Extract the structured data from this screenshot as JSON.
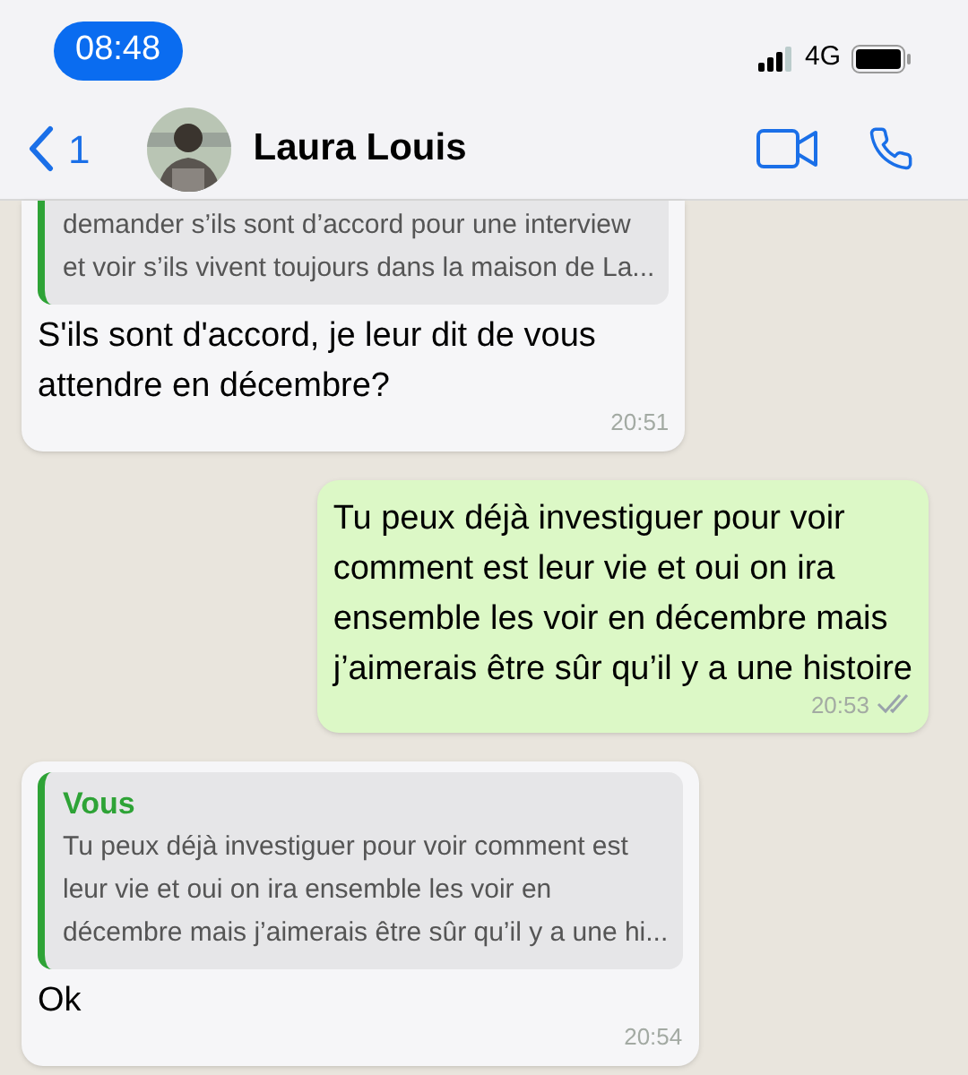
{
  "status_bar": {
    "time": "08:48",
    "network": "4G"
  },
  "header": {
    "back_count": "1",
    "contact": "Laura Louis"
  },
  "messages": [
    {
      "kind": "incoming",
      "quote": {
        "lines": [
          "demander s’ils sont d’accord pour une interview",
          "et voir s’ils vivent toujours dans la maison de La..."
        ]
      },
      "lines": [
        "S'ils sont d'accord, je leur dit de vous",
        "attendre en décembre?"
      ],
      "time": "20:51"
    },
    {
      "kind": "outgoing",
      "lines": [
        "Tu peux déjà investiguer pour voir",
        "comment est leur vie et oui on ira",
        "ensemble les voir en décembre mais",
        "j’aimerais être sûr qu’il y a une histoire"
      ],
      "time": "20:53",
      "read": false
    },
    {
      "kind": "incoming",
      "quote": {
        "author": "Vous",
        "lines": [
          "Tu peux déjà investiguer pour voir comment est",
          "leur vie et oui on ira ensemble les voir en",
          "décembre mais j’aimerais être sûr qu’il y a une hi..."
        ]
      },
      "lines": [
        "Ok"
      ],
      "time": "20:54"
    }
  ]
}
